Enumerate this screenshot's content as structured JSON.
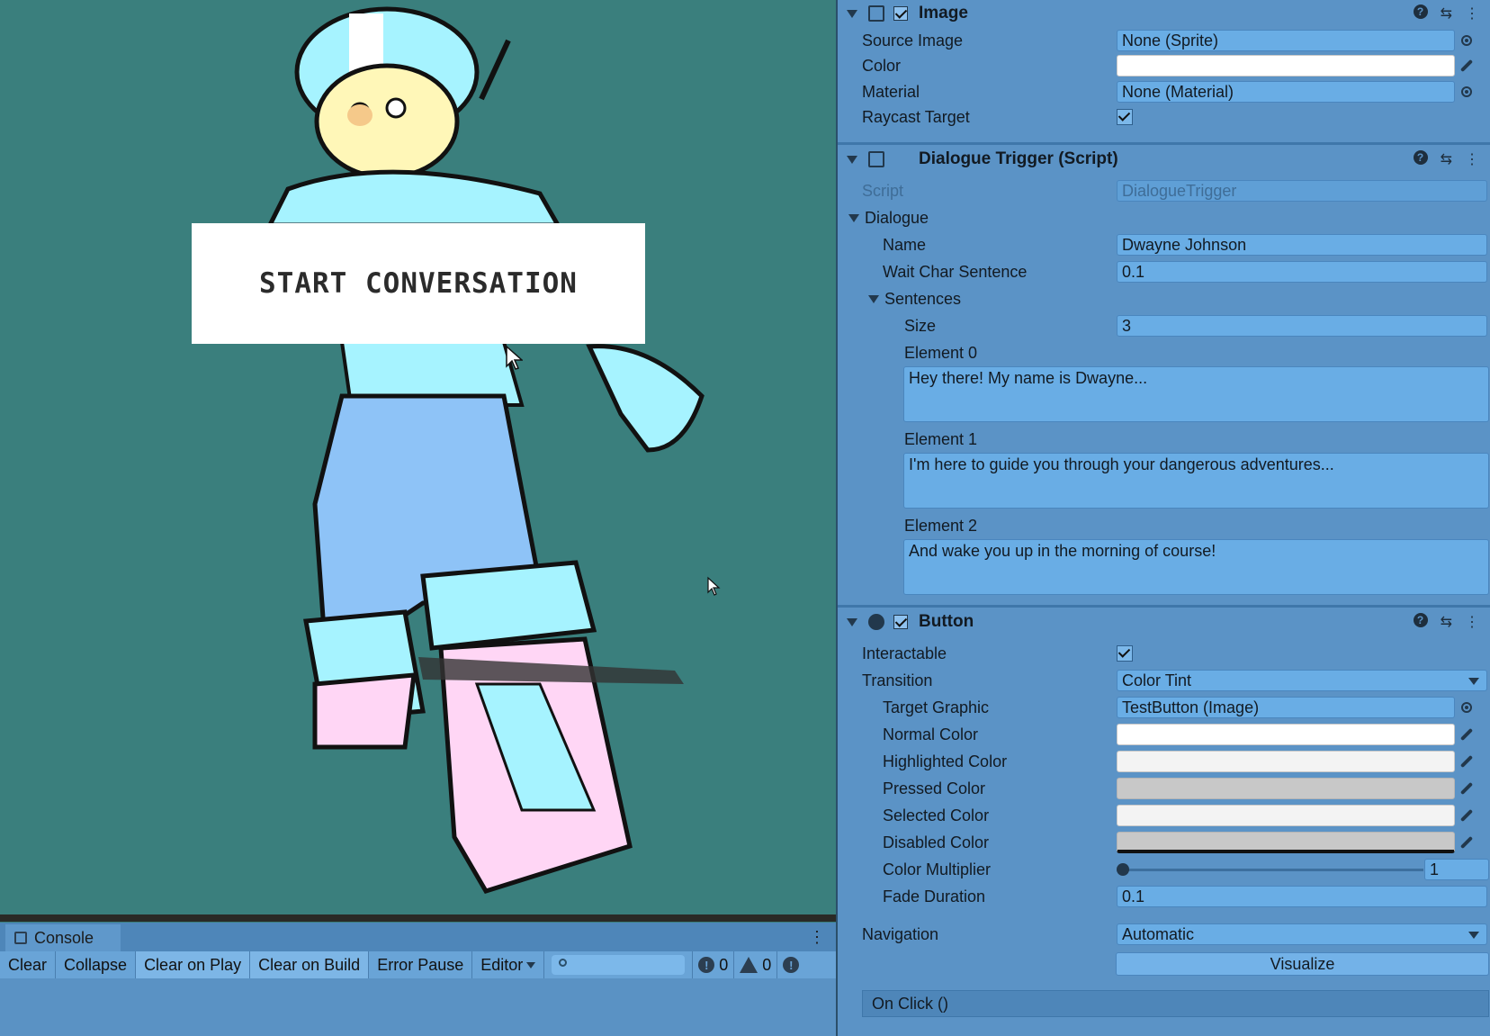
{
  "scene": {
    "start_button_label": "START CONVERSATION"
  },
  "console": {
    "tab_label": "Console",
    "menu_glyph": "⋮",
    "toolbar": [
      "Clear",
      "Collapse",
      "Clear on Play",
      "Clear on Build",
      "Error Pause",
      "Editor"
    ],
    "info_count": "0",
    "warning_count": "0"
  },
  "inspector": {
    "image": {
      "title": "Image",
      "source_image_label": "Source Image",
      "source_image_value": "None (Sprite)",
      "color_label": "Color",
      "material_label": "Material",
      "material_value": "None (Material)",
      "raycast_label": "Raycast Target",
      "raycast_checked": true
    },
    "dialogue_trigger": {
      "title": "Dialogue Trigger (Script)",
      "script_label": "Script",
      "script_value": "DialogueTrigger",
      "dialogue_label": "Dialogue",
      "name_label": "Name",
      "name_value": "Dwayne Johnson",
      "wait_label": "Wait Char Sentence",
      "wait_value": "0.1",
      "sentences_label": "Sentences",
      "size_label": "Size",
      "size_value": "3",
      "elements": [
        {
          "label": "Element 0",
          "text": "Hey there! My name is Dwayne..."
        },
        {
          "label": "Element 1",
          "text": "I'm here to guide you through your dangerous adventures..."
        },
        {
          "label": "Element 2",
          "text": "And wake you up in the morning of course!"
        }
      ]
    },
    "button": {
      "title": "Button",
      "interactable_label": "Interactable",
      "interactable_checked": true,
      "transition_label": "Transition",
      "transition_value": "Color Tint",
      "target_graphic_label": "Target Graphic",
      "target_graphic_value": "TestButton (Image)",
      "normal_label": "Normal Color",
      "highlighted_label": "Highlighted Color",
      "pressed_label": "Pressed Color",
      "selected_label": "Selected Color",
      "disabled_label": "Disabled Color",
      "multiplier_label": "Color Multiplier",
      "multiplier_value": "1",
      "fade_label": "Fade Duration",
      "fade_value": "0.1",
      "navigation_label": "Navigation",
      "navigation_value": "Automatic",
      "visualize_label": "Visualize",
      "onclick_label": "On Click ()"
    }
  },
  "colors": {
    "scene_bg": "#3a7f7d",
    "inspector_bg": "#5b93c6",
    "field_bg": "#69ade5",
    "normal_color": "#ffffff",
    "highlighted_color": "#f5f5f5",
    "pressed_color": "#c8c8c8",
    "selected_color": "#f5f5f5",
    "disabled_color": "#c8c8c8"
  },
  "icons": {
    "header_help": "help-icon",
    "header_preset": "preset-icon",
    "header_menu": "menu-icon"
  }
}
